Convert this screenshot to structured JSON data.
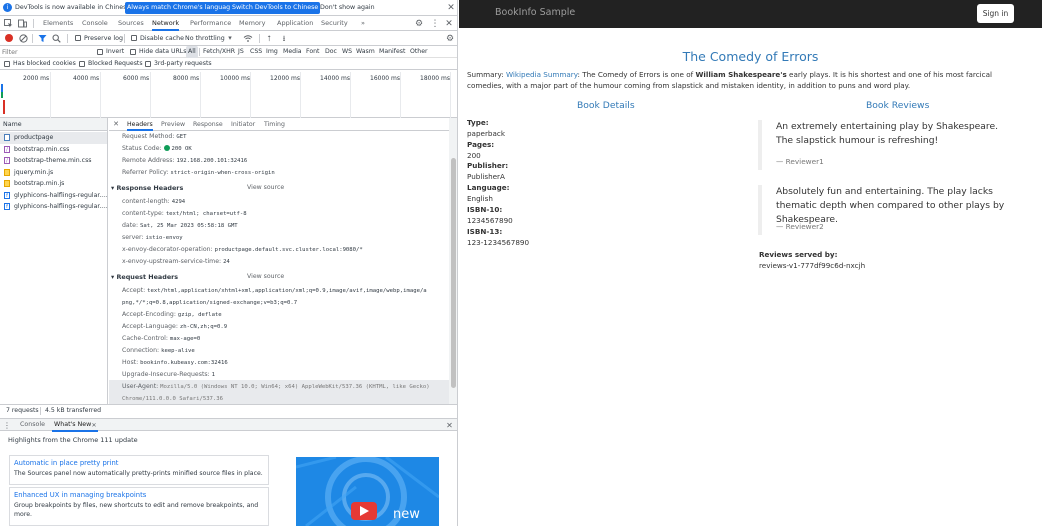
{
  "devtools": {
    "infobar": {
      "message": "DevTools is now available in Chinese!",
      "btn_match": "Always match Chrome's language",
      "btn_switch": "Switch DevTools to Chinese",
      "btn_dismiss": "Don't show again"
    },
    "tabs": [
      "Elements",
      "Console",
      "Sources",
      "Network",
      "Performance",
      "Memory",
      "Application",
      "Security"
    ],
    "active_tab": "Network",
    "more_tabs": "»",
    "toolbar": {
      "preserve_log": "Preserve log",
      "disable_cache": "Disable cache",
      "throttling": "No throttling"
    },
    "filter": {
      "placeholder": "Filter",
      "invert": "Invert",
      "hide_data_urls": "Hide data URLs",
      "types": [
        "All",
        "Fetch/XHR",
        "JS",
        "CSS",
        "Img",
        "Media",
        "Font",
        "Doc",
        "WS",
        "Wasm",
        "Manifest",
        "Other"
      ],
      "active_type": "All"
    },
    "blockbar": {
      "has_blocked_cookies": "Has blocked cookies",
      "blocked_requests": "Blocked Requests",
      "third_party": "3rd-party requests"
    },
    "timeline_ticks": [
      "2000 ms",
      "4000 ms",
      "6000 ms",
      "8000 ms",
      "10000 ms",
      "12000 ms",
      "14000 ms",
      "16000 ms",
      "18000 ms"
    ],
    "name_header": "Name",
    "requests": [
      {
        "name": "productpage",
        "type": "doc"
      },
      {
        "name": "bootstrap.min.css",
        "type": "css"
      },
      {
        "name": "bootstrap-theme.min.css",
        "type": "css"
      },
      {
        "name": "jquery.min.js",
        "type": "js"
      },
      {
        "name": "bootstrap.min.js",
        "type": "js"
      },
      {
        "name": "glyphicons-halflings-regular....",
        "type": "font"
      },
      {
        "name": "glyphicons-halflings-regular....",
        "type": "font"
      }
    ],
    "detail_tabs": [
      "Headers",
      "Preview",
      "Response",
      "Initiator",
      "Timing"
    ],
    "active_detail_tab": "Headers",
    "general": [
      {
        "k": "Request Method:",
        "v": "GET"
      },
      {
        "k": "Status Code:",
        "v": "200 OK"
      },
      {
        "k": "Remote Address:",
        "v": "192.168.200.101:32416"
      },
      {
        "k": "Referrer Policy:",
        "v": "strict-origin-when-cross-origin"
      }
    ],
    "response_headers_title": "Response Headers",
    "view_source": "View source",
    "response_headers": [
      {
        "k": "content-length:",
        "v": "4294"
      },
      {
        "k": "content-type:",
        "v": "text/html; charset=utf-8"
      },
      {
        "k": "date:",
        "v": "Sat, 25 Mar 2023 05:58:18 GMT"
      },
      {
        "k": "server:",
        "v": "istio-envoy"
      },
      {
        "k": "x-envoy-decorator-operation:",
        "v": "productpage.default.svc.cluster.local:9080/*"
      },
      {
        "k": "x-envoy-upstream-service-time:",
        "v": "24"
      }
    ],
    "request_headers_title": "Request Headers",
    "request_headers": [
      {
        "k": "Accept:",
        "v": "text/html,application/xhtml+xml,application/xml;q=0.9,image/avif,image/webp,image/a"
      },
      {
        "k": "",
        "v": "png,*/*;q=0.8,application/signed-exchange;v=b3;q=0.7"
      },
      {
        "k": "Accept-Encoding:",
        "v": "gzip, deflate"
      },
      {
        "k": "Accept-Language:",
        "v": "zh-CN,zh;q=0.9"
      },
      {
        "k": "Cache-Control:",
        "v": "max-age=0"
      },
      {
        "k": "Connection:",
        "v": "keep-alive"
      },
      {
        "k": "Host:",
        "v": "bookinfo.kubeasy.com:32416"
      },
      {
        "k": "Upgrade-Insecure-Requests:",
        "v": "1"
      },
      {
        "k": "User-Agent:",
        "v": "Mozilla/5.0 (Windows NT 10.0; Win64; x64) AppleWebKit/537.36 (KHTML, like Gecko)"
      },
      {
        "k": "",
        "v": "Chrome/111.0.0.0 Safari/537.36"
      }
    ],
    "status": {
      "requests": "7 requests",
      "transferred": "4.5 kB transferred"
    },
    "drawer": {
      "tab_console": "Console",
      "tab_whats_new": "What's New",
      "highlights": "Highlights from the Chrome 111 update",
      "cards": [
        {
          "title": "Automatic in place pretty print",
          "desc": "The Sources panel now automatically pretty-prints minified source files in place."
        },
        {
          "title": "Enhanced UX in managing breakpoints",
          "desc": "Group breakpoints by files, new shortcuts to edit and remove breakpoints, and more."
        }
      ],
      "video_label": "new"
    }
  },
  "app": {
    "brand": "BookInfo Sample",
    "sign_in": "Sign in",
    "title": "The Comedy of Errors",
    "summary_label": "Summary:",
    "summary_link": "Wikipedia Summary",
    "summary_text_1": ": The Comedy of Errors is one of ",
    "summary_bold": "William Shakespeare's",
    "summary_text_2": " early plays. It is his shortest and one of his most farcical comedies, with a major part of the humour coming from slapstick and mistaken identity, in addition to puns and word play.",
    "details_heading": "Book Details",
    "reviews_heading": "Book Reviews",
    "details": [
      {
        "label": "Type:",
        "value": "paperback"
      },
      {
        "label": "Pages:",
        "value": "200"
      },
      {
        "label": "Publisher:",
        "value": "PublisherA"
      },
      {
        "label": "Language:",
        "value": "English"
      },
      {
        "label": "ISBN-10:",
        "value": "1234567890"
      },
      {
        "label": "ISBN-13:",
        "value": "123-1234567890"
      }
    ],
    "reviews": [
      {
        "text": "An extremely entertaining play by Shakespeare. The slapstick humour is refreshing!",
        "author": "— Reviewer1"
      },
      {
        "text": "Absolutely fun and entertaining. The play lacks thematic depth when compared to other plays by Shakespeare.",
        "author": "— Reviewer2"
      }
    ],
    "served_by_label": "Reviews served by:",
    "served_by_value": "reviews-v1-777df99c6d-nxcjh"
  },
  "colors": {
    "accent": "#1a73e8",
    "link": "#337ab7",
    "navbar": "#222222",
    "status_ok": "#0f9d58",
    "record": "#d93025"
  }
}
